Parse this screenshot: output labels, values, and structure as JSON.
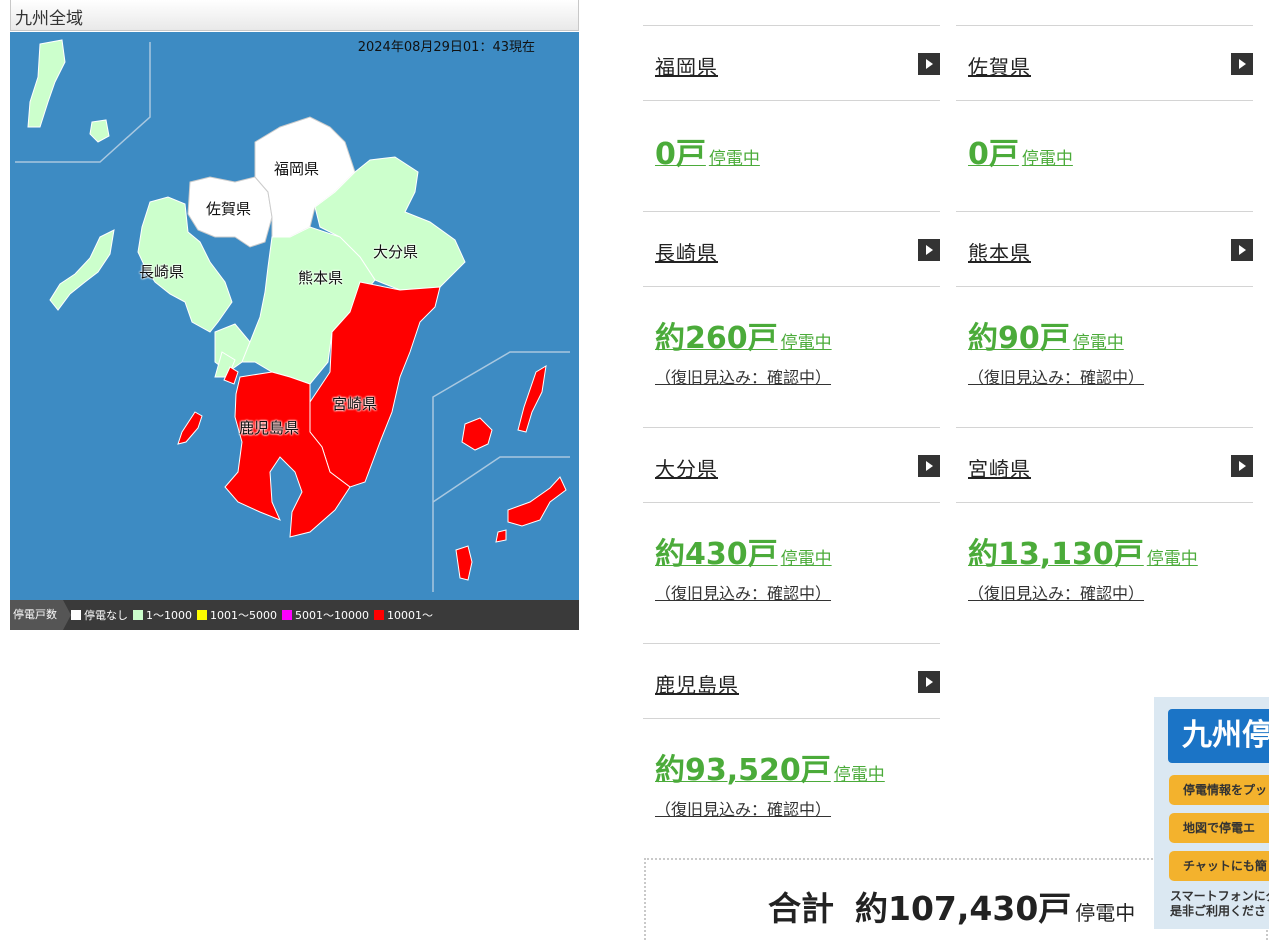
{
  "map": {
    "title": "九州全域",
    "timestamp": "2024年08月29日01：43現在",
    "labels": {
      "fukuoka": "福岡県",
      "saga": "佐賀県",
      "nagasaki": "長崎県",
      "kumamoto": "熊本県",
      "oita": "大分県",
      "miyazaki": "宮崎県",
      "kagoshima": "鹿児島県"
    },
    "legend": {
      "title": "停電戸数",
      "items": [
        {
          "label": "停電なし",
          "color": "#ffffff"
        },
        {
          "label": "1～1000",
          "color": "#ccffcc"
        },
        {
          "label": "1001～5000",
          "color": "#ffff00"
        },
        {
          "label": "5001～10000",
          "color": "#ff00ff"
        },
        {
          "label": "10001～",
          "color": "#ff0000"
        }
      ]
    }
  },
  "prefectures": [
    {
      "name": "福岡県",
      "outage": "0戸",
      "status": "停電中",
      "restore": ""
    },
    {
      "name": "佐賀県",
      "outage": "0戸",
      "status": "停電中",
      "restore": ""
    },
    {
      "name": "長崎県",
      "outage": "約260戸",
      "status": "停電中",
      "restore": "（復旧見込み：確認中）"
    },
    {
      "name": "熊本県",
      "outage": "約90戸",
      "status": "停電中",
      "restore": "（復旧見込み：確認中）"
    },
    {
      "name": "大分県",
      "outage": "約430戸",
      "status": "停電中",
      "restore": "（復旧見込み：確認中）"
    },
    {
      "name": "宮崎県",
      "outage": "約13,130戸",
      "status": "停電中",
      "restore": "（復旧見込み：確認中）"
    },
    {
      "name": "鹿児島県",
      "outage": "約93,520戸",
      "status": "停電中",
      "restore": "（復旧見込み：確認中）"
    }
  ],
  "total": {
    "label": "合計",
    "value": "約107,430戸",
    "status": "停電中"
  },
  "banner": {
    "title": "九州停",
    "buttons": [
      "停電情報をプッ",
      "地図で停電エ",
      "チャットにも簡"
    ],
    "foot_line1": "スマートフォンにダ",
    "foot_line2": "是非ご利用くださ"
  },
  "colors": {
    "sea": "#3d8bc3",
    "no_outage": "#ffffff",
    "low": "#ccffcc",
    "high": "#ff0000",
    "accent_green": "#4bab3a"
  }
}
